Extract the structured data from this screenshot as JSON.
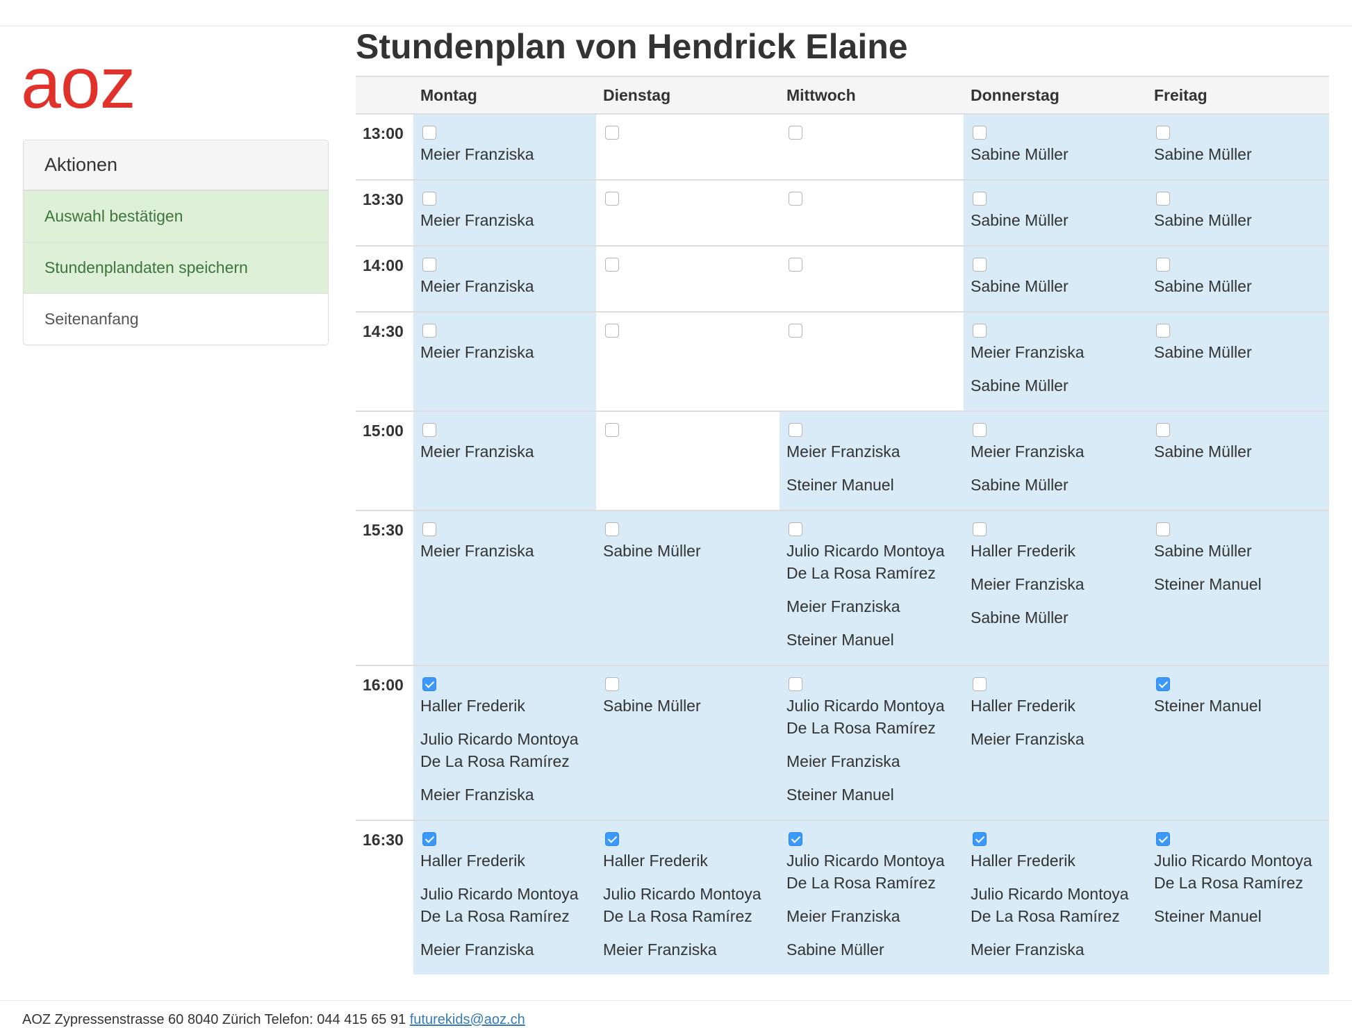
{
  "logo": {
    "text": "aoz",
    "color": "#e0322b"
  },
  "actions": {
    "title": "Aktionen",
    "items": [
      {
        "label": "Auswahl bestätigen",
        "style": "success"
      },
      {
        "label": "Stundenplandaten speichern",
        "style": "success"
      },
      {
        "label": "Seitenanfang",
        "style": "plain"
      }
    ]
  },
  "page": {
    "title": "Stundenplan von Hendrick Elaine"
  },
  "schedule": {
    "days": [
      "Montag",
      "Dienstag",
      "Mittwoch",
      "Donnerstag",
      "Freitag"
    ],
    "rows": [
      {
        "time": "13:00",
        "cells": [
          {
            "checked": false,
            "names": [
              "Meier Franziska"
            ]
          },
          {
            "checked": false,
            "names": []
          },
          {
            "checked": false,
            "names": []
          },
          {
            "checked": false,
            "names": [
              "Sabine Müller"
            ]
          },
          {
            "checked": false,
            "names": [
              "Sabine Müller"
            ]
          }
        ]
      },
      {
        "time": "13:30",
        "cells": [
          {
            "checked": false,
            "names": [
              "Meier Franziska"
            ]
          },
          {
            "checked": false,
            "names": []
          },
          {
            "checked": false,
            "names": []
          },
          {
            "checked": false,
            "names": [
              "Sabine Müller"
            ]
          },
          {
            "checked": false,
            "names": [
              "Sabine Müller"
            ]
          }
        ]
      },
      {
        "time": "14:00",
        "cells": [
          {
            "checked": false,
            "names": [
              "Meier Franziska"
            ]
          },
          {
            "checked": false,
            "names": []
          },
          {
            "checked": false,
            "names": []
          },
          {
            "checked": false,
            "names": [
              "Sabine Müller"
            ]
          },
          {
            "checked": false,
            "names": [
              "Sabine Müller"
            ]
          }
        ]
      },
      {
        "time": "14:30",
        "cells": [
          {
            "checked": false,
            "names": [
              "Meier Franziska"
            ]
          },
          {
            "checked": false,
            "names": []
          },
          {
            "checked": false,
            "names": []
          },
          {
            "checked": false,
            "names": [
              "Meier Franziska",
              "Sabine Müller"
            ]
          },
          {
            "checked": false,
            "names": [
              "Sabine Müller"
            ]
          }
        ]
      },
      {
        "time": "15:00",
        "cells": [
          {
            "checked": false,
            "names": [
              "Meier Franziska"
            ]
          },
          {
            "checked": false,
            "names": []
          },
          {
            "checked": false,
            "names": [
              "Meier Franziska",
              "Steiner Manuel"
            ]
          },
          {
            "checked": false,
            "names": [
              "Meier Franziska",
              "Sabine Müller"
            ]
          },
          {
            "checked": false,
            "names": [
              "Sabine Müller"
            ]
          }
        ]
      },
      {
        "time": "15:30",
        "cells": [
          {
            "checked": false,
            "names": [
              "Meier Franziska"
            ]
          },
          {
            "checked": false,
            "names": [
              "Sabine Müller"
            ]
          },
          {
            "checked": false,
            "names": [
              "Julio Ricardo Montoya De La Rosa Ramírez",
              "Meier Franziska",
              "Steiner Manuel"
            ]
          },
          {
            "checked": false,
            "names": [
              "Haller Frederik",
              "Meier Franziska",
              "Sabine Müller"
            ]
          },
          {
            "checked": false,
            "names": [
              "Sabine Müller",
              "Steiner Manuel"
            ]
          }
        ]
      },
      {
        "time": "16:00",
        "cells": [
          {
            "checked": true,
            "names": [
              "Haller Frederik",
              "Julio Ricardo Montoya De La Rosa Ramírez",
              "Meier Franziska"
            ]
          },
          {
            "checked": false,
            "names": [
              "Sabine Müller"
            ]
          },
          {
            "checked": false,
            "names": [
              "Julio Ricardo Montoya De La Rosa Ramírez",
              "Meier Franziska",
              "Steiner Manuel"
            ]
          },
          {
            "checked": false,
            "names": [
              "Haller Frederik",
              "Meier Franziska"
            ]
          },
          {
            "checked": true,
            "names": [
              "Steiner Manuel"
            ]
          }
        ]
      },
      {
        "time": "16:30",
        "cells": [
          {
            "checked": true,
            "names": [
              "Haller Frederik",
              "Julio Ricardo Montoya De La Rosa Ramírez",
              "Meier Franziska"
            ]
          },
          {
            "checked": true,
            "names": [
              "Haller Frederik",
              "Julio Ricardo Montoya De La Rosa Ramírez",
              "Meier Franziska"
            ]
          },
          {
            "checked": true,
            "names": [
              "Julio Ricardo Montoya De La Rosa Ramírez",
              "Meier Franziska",
              "Sabine Müller"
            ]
          },
          {
            "checked": true,
            "names": [
              "Haller Frederik",
              "Julio Ricardo Montoya De La Rosa Ramírez",
              "Meier Franziska"
            ]
          },
          {
            "checked": true,
            "names": [
              "Julio Ricardo Montoya De La Rosa Ramírez",
              "Steiner Manuel"
            ]
          }
        ]
      }
    ]
  },
  "footer": {
    "address": "AOZ Zypressenstrasse 60 8040 Zürich Telefon: 044 415 65 91",
    "email": "futurekids@aoz.ch"
  },
  "colors": {
    "available_cell": "#d9ebf6",
    "success_bg": "#dff0d8",
    "success_text": "#3c763d",
    "checkbox_checked": "#3b99fc",
    "link": "#337ab7"
  }
}
